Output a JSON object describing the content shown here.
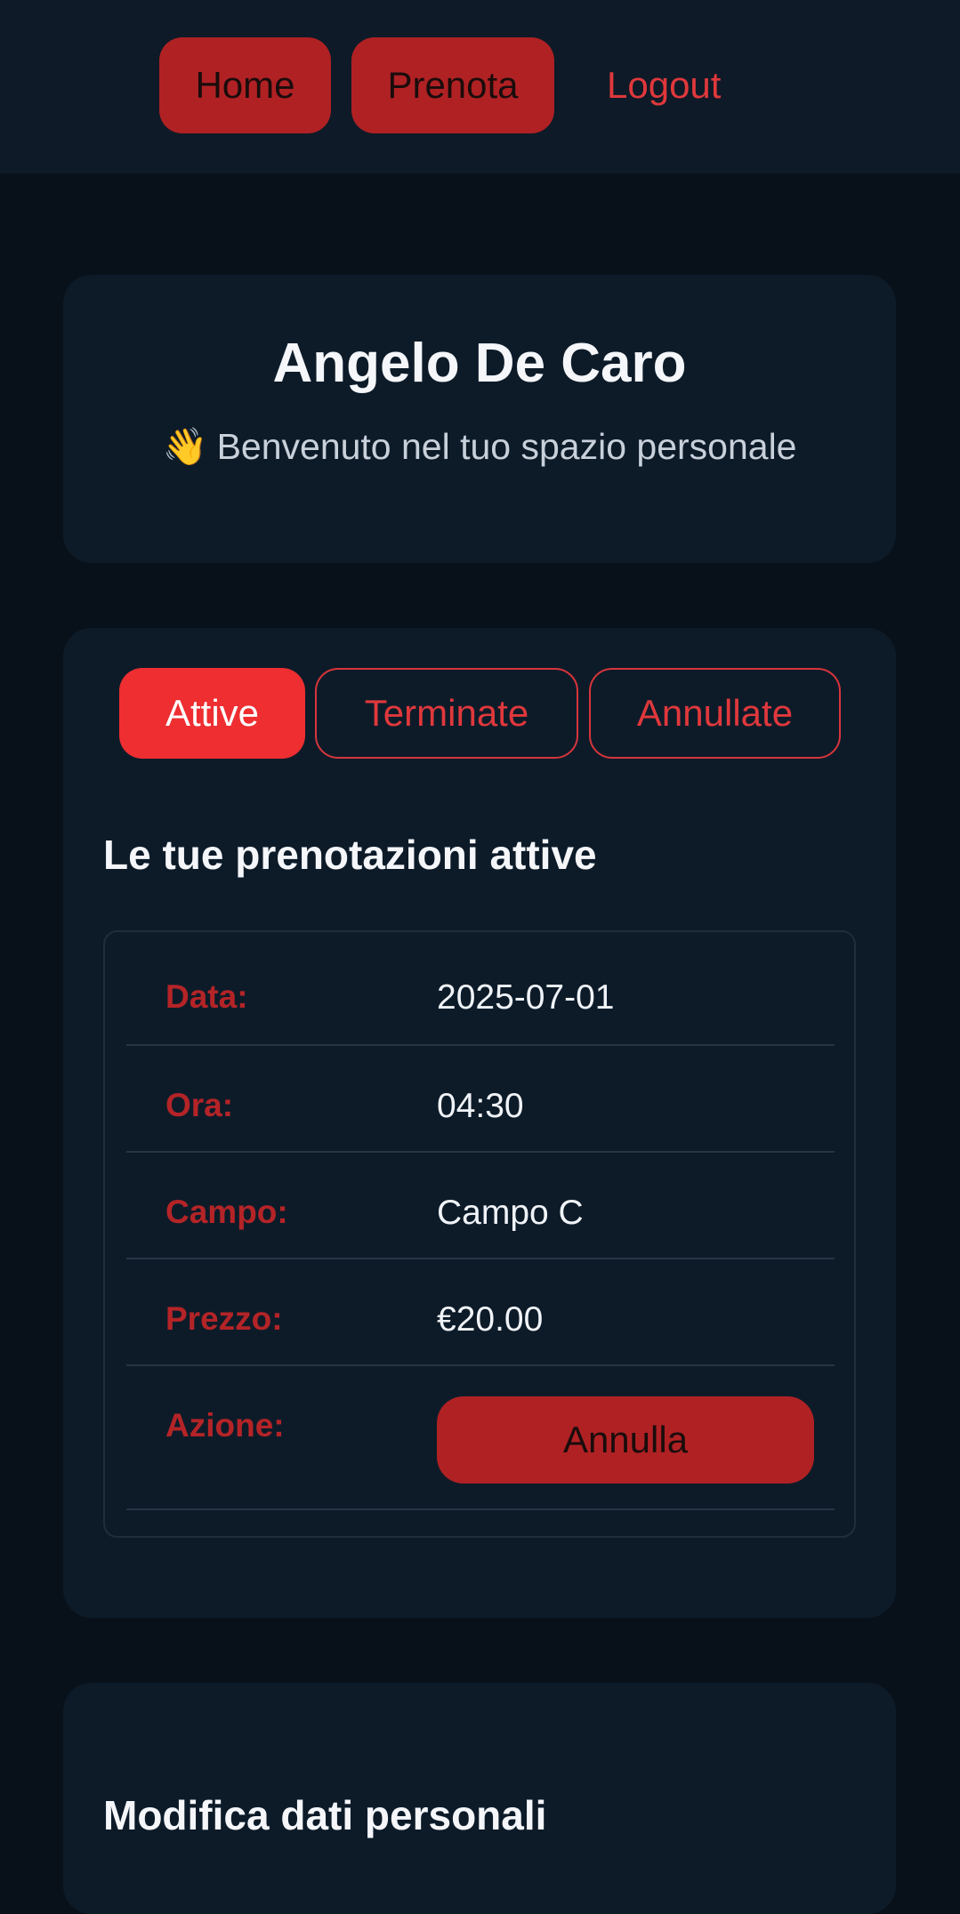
{
  "nav": {
    "home_label": "Home",
    "prenota_label": "Prenota",
    "logout_label": "Logout"
  },
  "welcome": {
    "user_name": "Angelo De Caro",
    "wave_emoji": "👋",
    "message": "Benvenuto nel tuo spazio personale"
  },
  "tabs": [
    {
      "label": "Attive",
      "active": true
    },
    {
      "label": "Terminate",
      "active": false
    },
    {
      "label": "Annullate",
      "active": false
    }
  ],
  "bookings": {
    "section_title": "Le tue prenotazioni attive",
    "rows": [
      {
        "label": "Data:",
        "value": "2025-07-01"
      },
      {
        "label": "Ora:",
        "value": "04:30"
      },
      {
        "label": "Campo:",
        "value": "Campo C"
      },
      {
        "label": "Prezzo:",
        "value": "€20.00"
      },
      {
        "label": "Azione:",
        "button_label": "Annulla"
      }
    ]
  },
  "profile": {
    "section_title": "Modifica dati personali"
  },
  "colors": {
    "background": "#08111a",
    "card": "#0d1b29",
    "accent_red": "#b02124",
    "active_tab": "#ee2e31",
    "label_red": "#b42427"
  }
}
